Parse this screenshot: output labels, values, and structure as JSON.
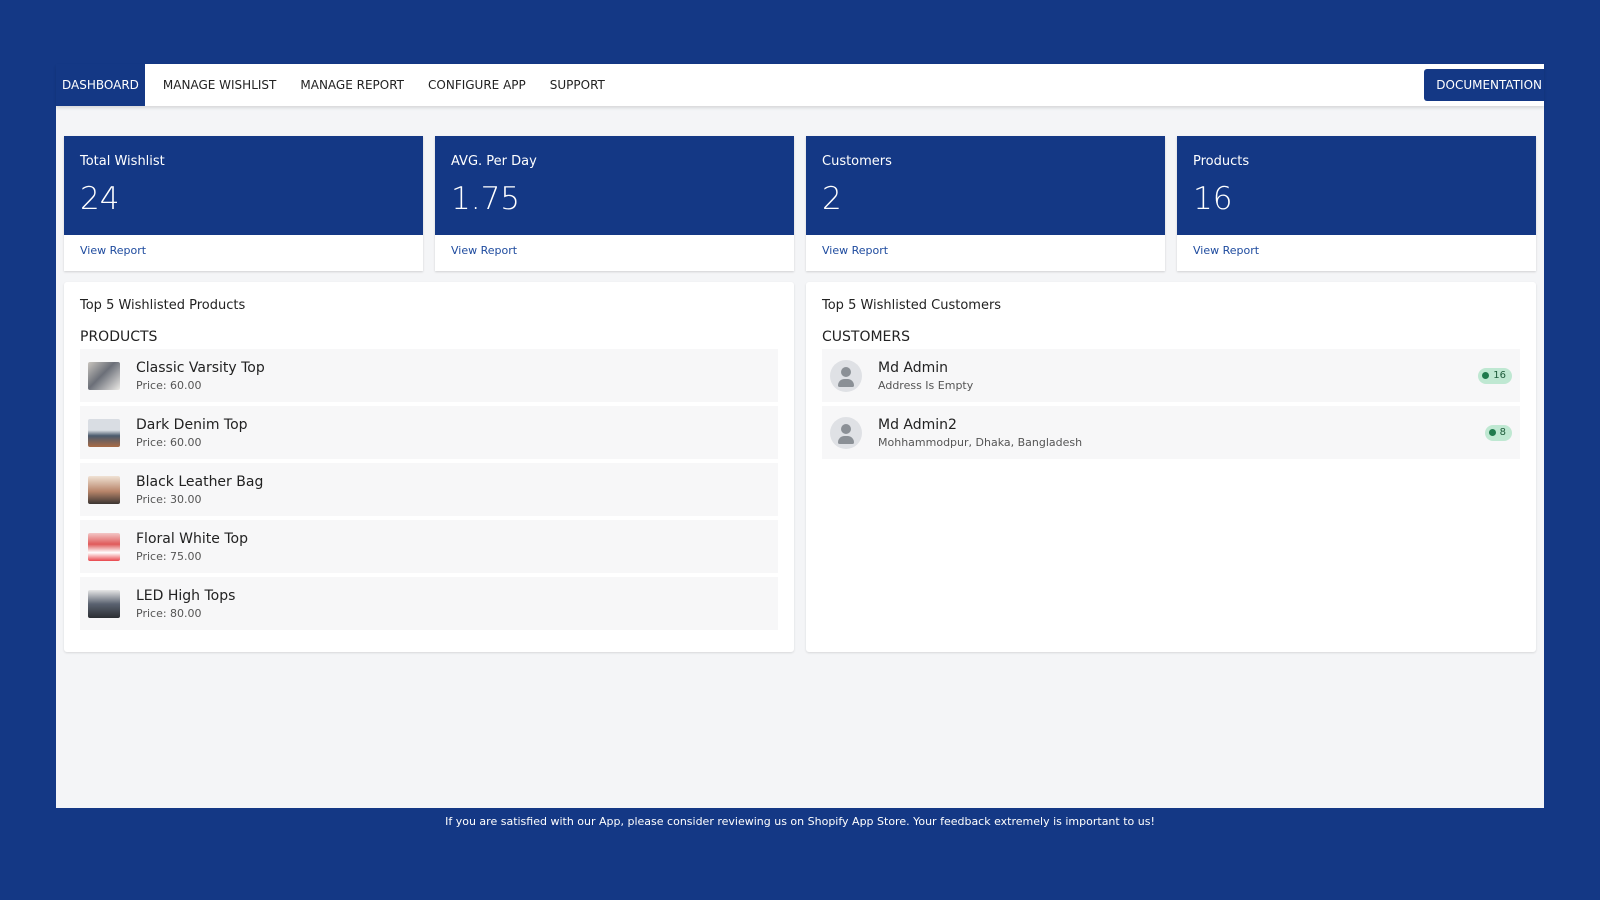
{
  "nav": {
    "tabs": [
      {
        "label": "DASHBOARD",
        "active": true
      },
      {
        "label": "MANAGE WISHLIST"
      },
      {
        "label": "MANAGE REPORT"
      },
      {
        "label": "CONFIGURE APP"
      },
      {
        "label": "SUPPORT"
      }
    ],
    "documentation_label": "DOCUMENTATION"
  },
  "stats": [
    {
      "title": "Total Wishlist",
      "value": "24",
      "link": "View Report"
    },
    {
      "title": "AVG. Per Day",
      "value": "1.75",
      "link": "View Report"
    },
    {
      "title": "Customers",
      "value": "2",
      "link": "View Report"
    },
    {
      "title": "Products",
      "value": "16",
      "link": "View Report"
    }
  ],
  "products_panel": {
    "title": "Top 5 Wishlisted Products",
    "subtitle": "PRODUCTS",
    "items": [
      {
        "name": "Classic Varsity Top",
        "price": "Price: 60.00"
      },
      {
        "name": "Dark Denim Top",
        "price": "Price: 60.00"
      },
      {
        "name": "Black Leather Bag",
        "price": "Price: 30.00"
      },
      {
        "name": "Floral White Top",
        "price": "Price: 75.00"
      },
      {
        "name": "LED High Tops",
        "price": "Price: 80.00"
      }
    ]
  },
  "customers_panel": {
    "title": "Top 5 Wishlisted Customers",
    "subtitle": "CUSTOMERS",
    "items": [
      {
        "name": "Md Admin",
        "address": "Address Is Empty",
        "count": "16"
      },
      {
        "name": "Md Admin2",
        "address": "Mohhammodpur, Dhaka, Bangladesh",
        "count": "8"
      }
    ]
  },
  "footer": {
    "text": "If you are satisfied with our App, please consider reviewing us on Shopify App Store. Your feedback extremely is important to us!"
  },
  "colors": {
    "background": "#143885",
    "accent": "#143885",
    "badge_bg": "#bfe8d2",
    "badge_dot": "#1f7a4d"
  }
}
